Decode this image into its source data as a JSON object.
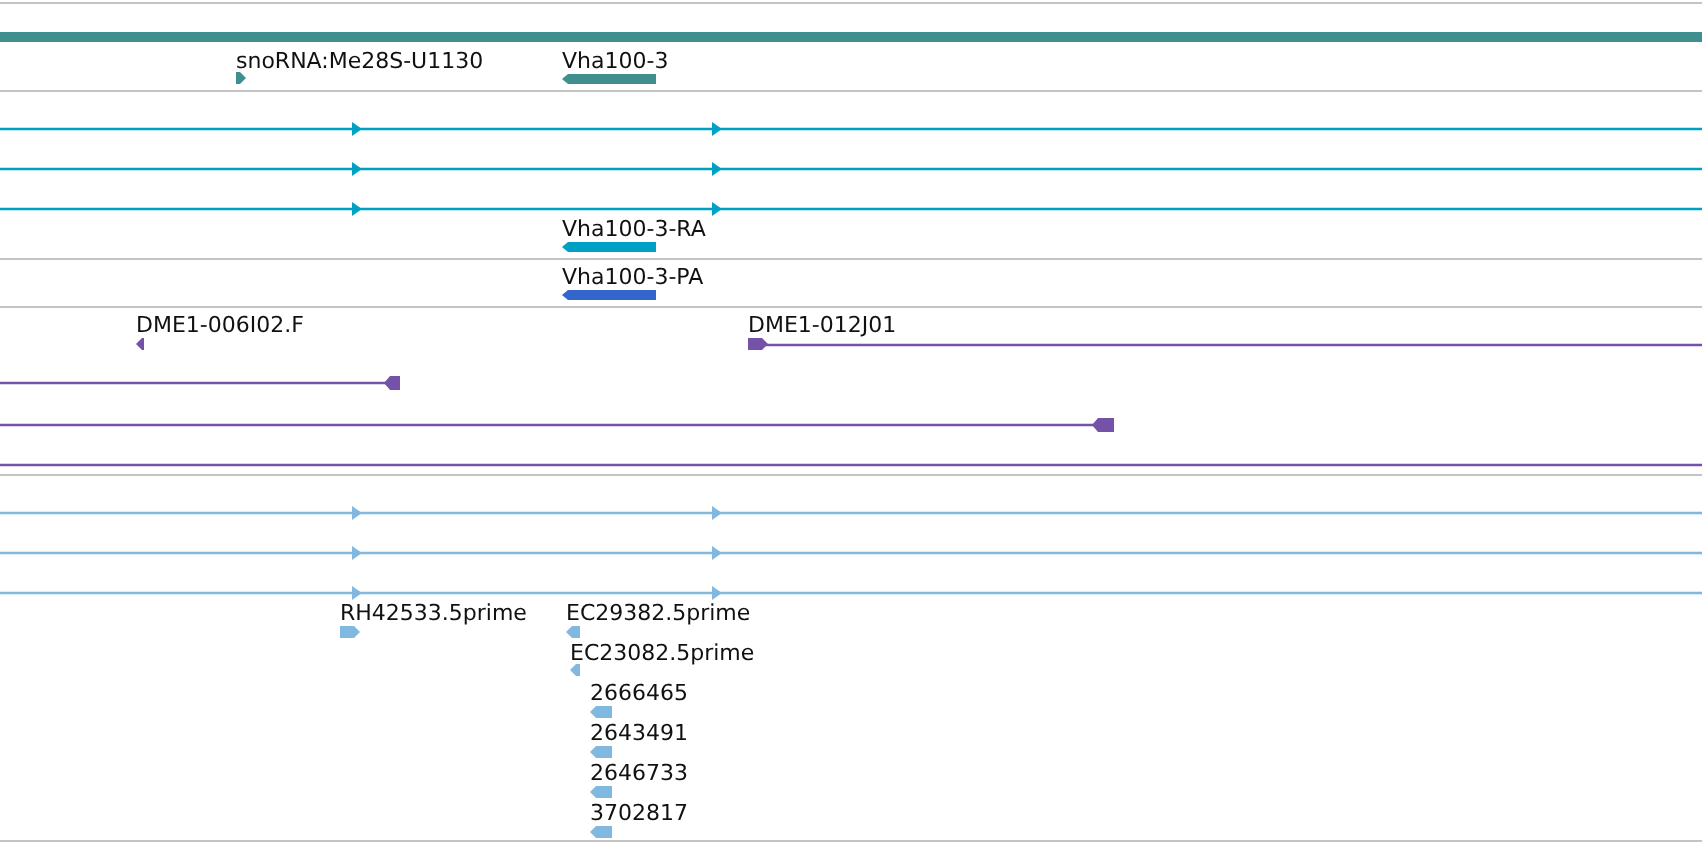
{
  "tracks": [
    {
      "kind": "gene",
      "color": "#3f8f8f",
      "features": [
        {
          "label": "snoRNA:Me28S-U1130",
          "reverse": false
        },
        {
          "label": "Vha100-3",
          "reverse": true
        }
      ]
    },
    {
      "kind": "transcript",
      "color": "#00a0c4",
      "features": [
        {
          "label": "Vha100-3-RA",
          "reverse": true
        }
      ]
    },
    {
      "kind": "protein",
      "color": "#3366cc",
      "features": [
        {
          "label": "Vha100-3-PA",
          "reverse": true
        }
      ]
    },
    {
      "kind": "clone",
      "color": "#7452a8",
      "features": [
        {
          "label": "DME1-006I02.F",
          "reverse": true
        },
        {
          "label": "DME1-012J01",
          "reverse": false
        }
      ]
    },
    {
      "kind": "est",
      "color": "#80b8e0",
      "features": [
        {
          "label": "RH42533.5prime",
          "reverse": false
        },
        {
          "label": "EC29382.5prime",
          "reverse": true
        },
        {
          "label": "EC23082.5prime",
          "reverse": true
        },
        {
          "label": "2666465",
          "reverse": true
        },
        {
          "label": "2643491",
          "reverse": true
        },
        {
          "label": "2646733",
          "reverse": true
        },
        {
          "label": "3702817",
          "reverse": true
        }
      ]
    }
  ]
}
